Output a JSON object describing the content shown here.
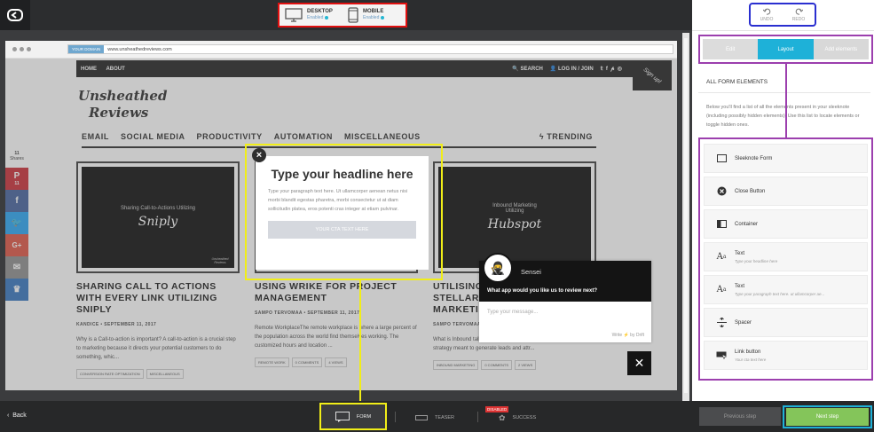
{
  "devices": [
    {
      "label": "DESKTOP",
      "status": "Enabled"
    },
    {
      "label": "MOBILE",
      "status": "Enabled"
    }
  ],
  "history": {
    "undo": "UNDO",
    "redo": "REDO"
  },
  "panel": {
    "tabs": [
      "Edit",
      "Layout",
      "Add elements"
    ],
    "active_tab": "Layout",
    "heading": "ALL FORM ELEMENTS",
    "description": "Below you'll find a list of all the elements present in your sleeknote (including possibly hidden elements). Use this list to locate elements or toggle hidden ones.",
    "elements": [
      {
        "icon": "form-icon",
        "name": "Sleeknote Form",
        "desc": ""
      },
      {
        "icon": "close-circle-icon",
        "name": "Close Button",
        "desc": ""
      },
      {
        "icon": "container-icon",
        "name": "Container",
        "desc": ""
      },
      {
        "icon": "text-icon",
        "name": "Text",
        "desc": "Type your headline here"
      },
      {
        "icon": "text-icon",
        "name": "Text",
        "desc": "Type your paragraph text here. ut ullamcorper ae..."
      },
      {
        "icon": "spacer-icon",
        "name": "Spacer",
        "desc": ""
      },
      {
        "icon": "link-button-icon",
        "name": "Link button",
        "desc": "Your cta text here"
      }
    ]
  },
  "browser": {
    "url_tag": "YOUR DOMAIN",
    "url": "www.unsheathedreviews.com"
  },
  "site": {
    "nav_left": [
      "HOME",
      "ABOUT"
    ],
    "nav_right": [
      "SEARCH",
      "LOG IN / JOIN"
    ],
    "ribbon": "Sign up!",
    "logo_line1": "Unsheathed",
    "logo_line2": "Reviews",
    "menu": [
      "EMAIL",
      "SOCIAL MEDIA",
      "PRODUCTIVITY",
      "AUTOMATION",
      "MISCELLANEOUS"
    ],
    "trending": "TRENDING",
    "share_count": "11",
    "share_label": "Shares",
    "pinterest_count": "11",
    "posts": [
      {
        "thumb_top": "Sharing Call-to-Actions Utilizing",
        "thumb_brand": "Sniply",
        "thumb_corner": "Unsheathed Reviews",
        "title": "SHARING CALL TO ACTIONS WITH EVERY LINK UTILIZING SNIPLY",
        "meta": "KANDICE  •  SEPTEMBER 11, 2017",
        "excerpt": "Why is a Call-to-action is important? A call-to-action is a crucial step to marketing because it directs your potential customers to do something, whic...",
        "tags": [
          "CONVERSION RATE OPTIMIZATION",
          "MISCELLANEOUS"
        ]
      },
      {
        "thumb_top": "",
        "thumb_brand": "",
        "thumb_corner": "",
        "title": "USING WRIKE FOR PROJECT MANAGEMENT",
        "meta": "SAMPO TERVOMAA  •  SEPTEMBER 11, 2017",
        "excerpt": "Remote WorkplaceThe remote workplace is where a large percent of the population across the world find themselves working. The customized hours and location ...",
        "tags": [
          "REMOTE WORK",
          "0 COMMENTS",
          "4 VIEWS"
        ]
      },
      {
        "thumb_top": "Inbound Marketing Utilizing",
        "thumb_brand": "Hubspot",
        "thumb_corner": "Unsheathed",
        "title": "UTILISING STELLAR MARKETING",
        "meta": "SAMPO TERVOMAA",
        "excerpt": "What is Inbound talk about inbound marketing, they're referring to a strategy meant to generate leads and attr...",
        "tags": [
          "INBOUND MARKETING",
          "0 COMMENTS",
          "2 VIEWS"
        ]
      }
    ]
  },
  "popup": {
    "headline": "Type your headline here",
    "paragraph": "Type your paragraph text here. Ut ullamcorper aenean netus nisi morbi blandit egestas pharetra, morbi consectetur ut at diam sollicitudin platea, eros potenti cras integer at etiam pulvinar.",
    "cta": "YOUR CTA TEXT HERE",
    "close": "×"
  },
  "chat": {
    "agent": "Sensei",
    "question": "What app would you like us to review next?",
    "placeholder": "Type your message...",
    "footer": "Write ⚡ by Drift",
    "close": "✕"
  },
  "bottom": {
    "back": "Back",
    "steps": [
      "FORM",
      "TEASER",
      "SUCCESS"
    ],
    "disabled": "DISABLED",
    "prev": "Previous step",
    "next": "Next step"
  },
  "colors": {
    "accent": "#1eb1d8",
    "next_green": "#84c55a",
    "highlight_red": "#e01010",
    "highlight_blue": "#2a2fd0",
    "highlight_purple": "#9c3fae",
    "highlight_yellow": "#f1ee18"
  }
}
